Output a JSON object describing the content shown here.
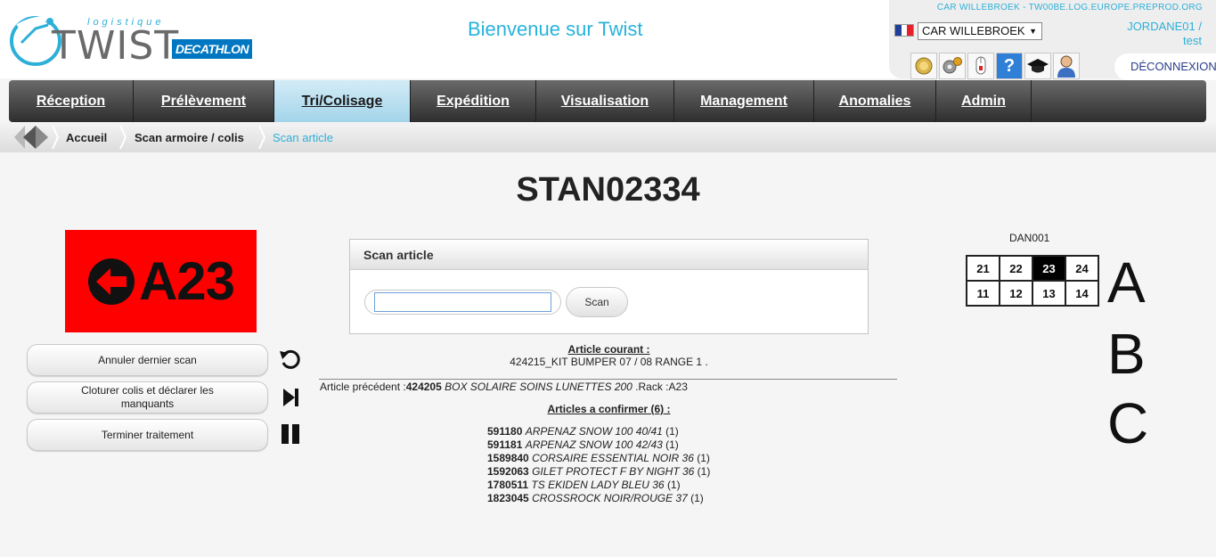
{
  "header": {
    "logo_small": "logistique",
    "logo_main": "TWIST",
    "brand": "DECATHLON",
    "welcome": "Bienvenue sur Twist",
    "server": "CAR WILLEBROEK - TW00BE.LOG.EUROPE.PREPROD.ORG",
    "site": "CAR WILLEBROEK",
    "user_line1": "JORDANE01 /",
    "user_line2": "test",
    "logout": "DÉCONNEXION"
  },
  "nav": {
    "items": [
      "Réception",
      "Prélèvement",
      "Tri/Colisage",
      "Expédition",
      "Visualisation",
      "Management",
      "Anomalies",
      "Admin"
    ],
    "active": "Tri/Colisage"
  },
  "breadcrumb": {
    "items": [
      "Accueil",
      "Scan armoire / colis",
      "Scan article"
    ]
  },
  "main": {
    "title": "STAN02334",
    "location": "A23",
    "actions": [
      "Annuler dernier scan",
      "Cloturer colis et déclarer les manquants",
      "Terminer traitement"
    ],
    "scan_panel": {
      "title": "Scan article",
      "input_value": "",
      "button": "Scan"
    },
    "current": {
      "label": "Article courant :",
      "value": "424215_KIT BUMPER 07 / 08 RANGE 1 ."
    },
    "previous": {
      "prefix": "Article précédent :",
      "code": "424205",
      "name": " BOX SOLAIRE SOINS LUNETTES 200 ",
      "rack": ".Rack :A23"
    },
    "to_confirm": {
      "title": "Articles a confirmer (6) :",
      "items": [
        {
          "code": "591180",
          "name": "ARPENAZ SNOW 100 40/41",
          "qty": "(1)"
        },
        {
          "code": "591181",
          "name": "ARPENAZ SNOW 100 42/43",
          "qty": "(1)"
        },
        {
          "code": "1589840",
          "name": "CORSAIRE ESSENTIAL NOIR 36",
          "qty": "(1)"
        },
        {
          "code": "1592063",
          "name": "GILET PROTECT F BY NIGHT 36",
          "qty": "(1)"
        },
        {
          "code": "1780511",
          "name": "TS EKIDEN LADY BLEU 36",
          "qty": "(1)"
        },
        {
          "code": "1823045",
          "name": "CROSSROCK NOIR/ROUGE 37",
          "qty": "(1)"
        }
      ]
    },
    "rack": {
      "label": "DAN001",
      "cells_row1": [
        "21",
        "22",
        "23",
        "24"
      ],
      "cells_row2": [
        "11",
        "12",
        "13",
        "14"
      ],
      "selected": "23",
      "rows": [
        "A",
        "B",
        "C"
      ]
    }
  },
  "colors": {
    "accent": "#28b3dc",
    "location_bg": "#ff0000",
    "nav_active": "#a4d4ea"
  }
}
